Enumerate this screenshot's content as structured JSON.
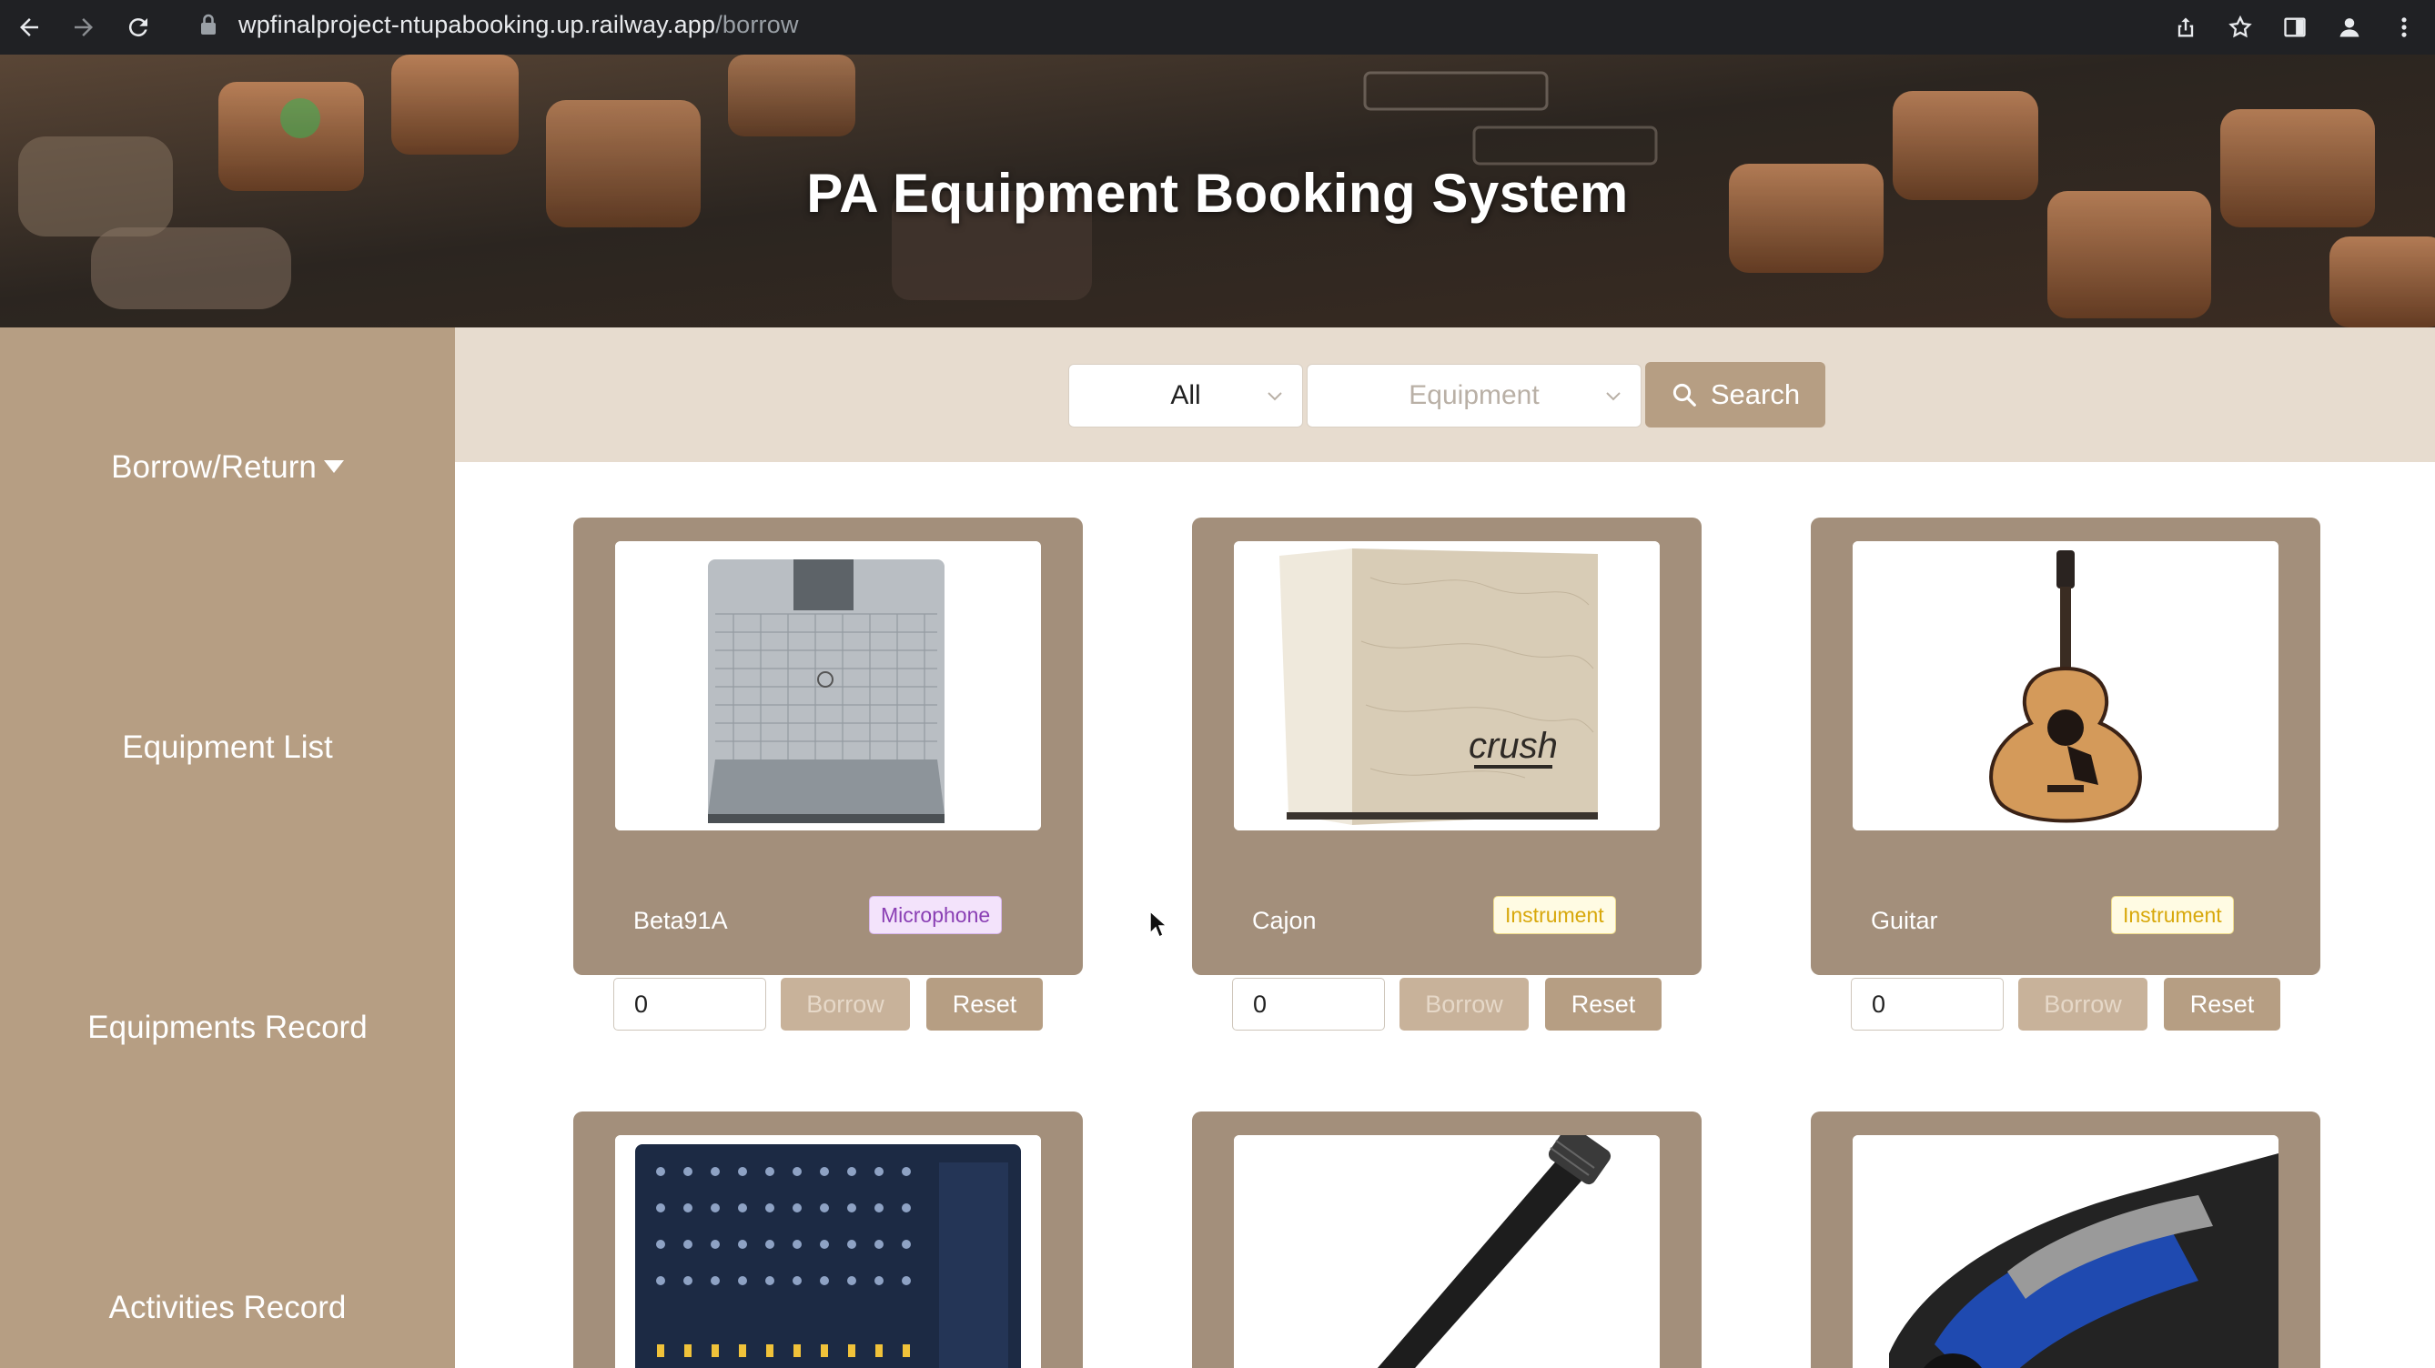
{
  "browser": {
    "url_host": "wpfinalproject-ntupabooking.up.railway.app",
    "url_path": "/borrow"
  },
  "banner": {
    "title": "PA Equipment Booking System"
  },
  "sidebar": {
    "items": [
      {
        "label": "Borrow/Return",
        "has_dropdown": true
      },
      {
        "label": "Equipment List"
      },
      {
        "label": "Equipments Record"
      },
      {
        "label": "Activities Record"
      }
    ]
  },
  "filters": {
    "category_select": {
      "value": "All"
    },
    "equipment_select": {
      "placeholder": "Equipment"
    },
    "search_label": "Search"
  },
  "cards": [
    {
      "name": "Beta91A",
      "tag": "Microphone",
      "tag_type": "mic",
      "quantity": "0",
      "borrow_label": "Borrow",
      "reset_label": "Reset",
      "image": "boundary-microphone"
    },
    {
      "name": "Cajon",
      "tag": "Instrument",
      "tag_type": "instrument",
      "quantity": "0",
      "borrow_label": "Borrow",
      "reset_label": "Reset",
      "image": "cajon",
      "image_text": "crush"
    },
    {
      "name": "Guitar",
      "tag": "Instrument",
      "tag_type": "instrument",
      "quantity": "0",
      "borrow_label": "Borrow",
      "reset_label": "Reset",
      "image": "acoustic-guitar"
    },
    {
      "image": "mixer-console"
    },
    {
      "image": "condenser-microphone"
    },
    {
      "image": "speakon-connector"
    }
  ],
  "colors": {
    "sidebar": "#b69e83",
    "filterbar": "#e7dccf",
    "card": "#a38f7b",
    "tag_mic_text": "#8a3fb4",
    "tag_instrument_text": "#d8a80c"
  }
}
